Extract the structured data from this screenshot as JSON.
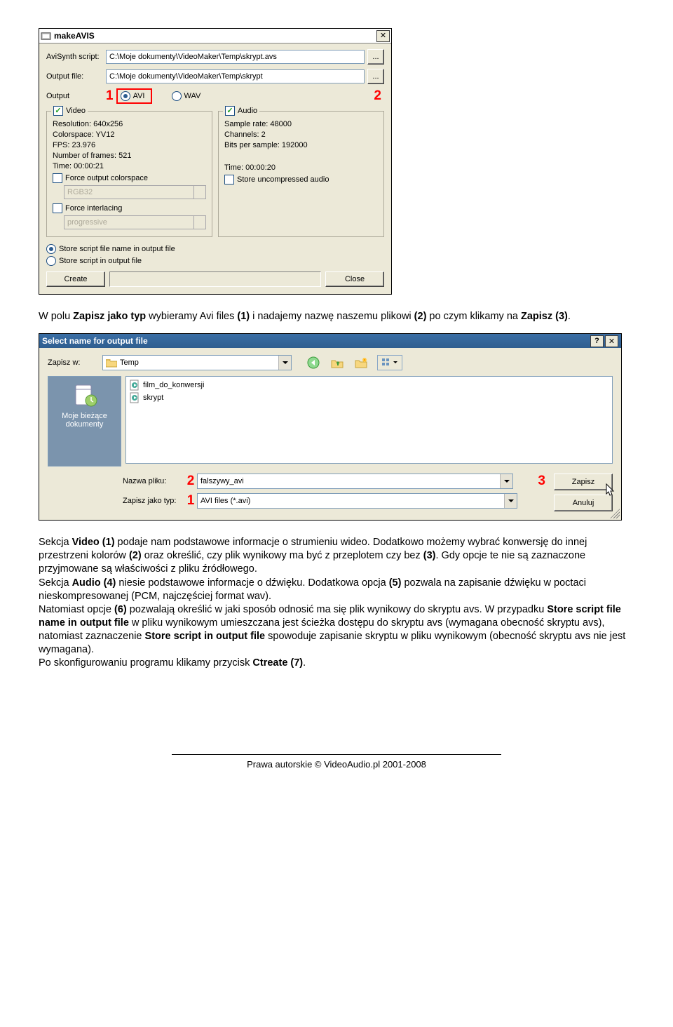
{
  "makeavis": {
    "title": "makeAVIS",
    "script_label": "AviSynth script:",
    "script_value": "C:\\Moje dokumenty\\VideoMaker\\Temp\\skrypt.avs",
    "output_label": "Output file:",
    "output_value": "C:\\Moje dokumenty\\VideoMaker\\Temp\\skrypt",
    "output_radio_label": "Output",
    "marker1": "1",
    "avi_label": "AVI",
    "wav_label": "WAV",
    "marker2": "2",
    "video": {
      "legend": "Video",
      "resolution": "Resolution: 640x256",
      "colorspace": "Colorspace: YV12",
      "fps": "FPS: 23.976",
      "frames": "Number of frames: 521",
      "time": "Time: 00:00:21",
      "force_colorspace": "Force output colorspace",
      "combo_cs": "RGB32",
      "force_interlacing": "Force interlacing",
      "combo_il": "progressive"
    },
    "audio": {
      "legend": "Audio",
      "sample": "Sample rate: 48000",
      "channels": "Channels: 2",
      "bits": "Bits per sample: 192000",
      "time": "Time: 00:00:20",
      "store_uncompressed": "Store uncompressed audio"
    },
    "store_name": "Store script file name in output file",
    "store_script": "Store script in output file",
    "create": "Create",
    "close": "Close"
  },
  "paragraph1": {
    "p1_a": "W polu ",
    "p1_b": "Zapisz jako typ",
    "p1_c": " wybieramy Avi files ",
    "p1_d": "(1)",
    "p1_e": " i nadajemy nazwę naszemu plikowi ",
    "p1_f": "(2)",
    "p1_g": " po czym klikamy na ",
    "p1_h": "Zapisz (3)",
    "p1_i": "."
  },
  "savedlg": {
    "title": "Select name for output file",
    "zapisz_w": "Zapisz w:",
    "folder": "Temp",
    "places_label": "Moje bieżące dokumenty",
    "file1": "film_do_konwersji",
    "file2": "skrypt",
    "nazwa_pliku": "Nazwa pliku:",
    "nazwa_value": "falszywy_avi",
    "zapisz_typ": "Zapisz jako typ:",
    "typ_value": "AVI files (*.avi)",
    "btn_zapisz": "Zapisz",
    "btn_anuluj": "Anuluj",
    "marker1": "1",
    "marker2": "2",
    "marker3": "3"
  },
  "paragraph2": {
    "t1": "Sekcja ",
    "t2": "Video (1)",
    "t3": " podaje nam podstawowe informacje o strumieniu wideo. Dodatkowo możemy wybrać konwersję do innej przestrzeni kolorów ",
    "t4": "(2)",
    "t5": " oraz określić, czy plik wynikowy ma być z przeplotem czy bez ",
    "t6": "(3)",
    "t7": ". Gdy opcje te nie są zaznaczone przyjmowane są właściwości z pliku źródłowego.",
    "t8": "Sekcja ",
    "t9": "Audio (4)",
    "t10": " niesie podstawowe informacje o dźwięku. Dodatkowa opcja ",
    "t11": "(5)",
    "t12": " pozwala na zapisanie dźwięku w poctaci nieskompresowanej (PCM, najczęściej format wav).",
    "t13": "Natomiast opcje ",
    "t14": "(6)",
    "t15": " pozwalają określić w jaki sposób odnosić ma się plik wynikowy do skryptu avs. W przypadku ",
    "t16": "Store script file name in output file",
    "t17": " w pliku wynikowym umieszczana jest ścieżka dostępu do skryptu avs (wymagana obecność skryptu avs), natomiast zaznaczenie ",
    "t18": "Store script in output file",
    "t19": " spowoduje zapisanie skryptu w pliku wynikowym (obecność skryptu avs nie jest wymagana).",
    "t20": "Po skonfigurowaniu programu klikamy przycisk ",
    "t21": "Ctreate (7)",
    "t22": "."
  },
  "footer": "Prawa autorskie © VideoAudio.pl 2001-2008"
}
